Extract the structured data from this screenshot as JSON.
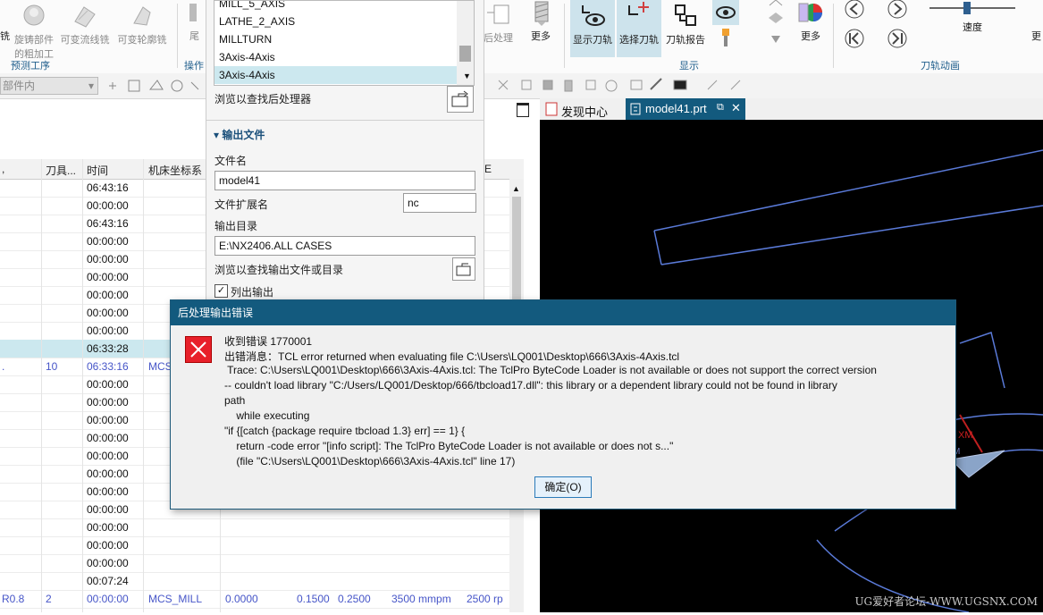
{
  "ribbon": {
    "left_buttons": [
      {
        "label": "旋铸部件\n的粗加工",
        "icon": "cast-part-icon"
      },
      {
        "label": "可变流线铣",
        "icon": "streamline-icon"
      },
      {
        "label": "可变轮廓铣",
        "icon": "variable-contour-icon"
      }
    ],
    "group_predict": "预测工序",
    "group_ops_partial": "操作",
    "partial_left_label": "铣",
    "partial_label2": "尾",
    "postprocess_partial": "后处理",
    "more_label_1": "更多",
    "show_toolpath": "显示刀轨",
    "select_toolpath": "选择刀轨",
    "toolpath_report": "刀轨报告",
    "more_label_2": "更多",
    "group_display": "显示",
    "speed_label": "速度",
    "more_label_3": "更",
    "group_animation": "刀轨动画"
  },
  "toolbar2": {
    "filter_value": "部件内"
  },
  "grid": {
    "headers": [
      "刀具...",
      "时间",
      "机床坐标系",
      "E"
    ],
    "rows": [
      {
        "time": "06:43:16"
      },
      {
        "time": "00:00:00"
      },
      {
        "time": "06:43:16"
      },
      {
        "time": "00:00:00"
      },
      {
        "time": "00:00:00"
      },
      {
        "time": "00:00:00"
      },
      {
        "time": "00:00:00"
      },
      {
        "time": "00:00:00"
      },
      {
        "time": "00:00:00"
      },
      {
        "time": "06:33:28",
        "selected": true
      },
      {
        "name": ".",
        "tool": "10",
        "time": "06:33:16",
        "mcs": "MCS",
        "blue": true
      },
      {
        "time": "00:00:00"
      },
      {
        "time": "00:00:00"
      },
      {
        "time": "00:00:00"
      },
      {
        "time": "00:00:00"
      },
      {
        "time": "00:00:00"
      },
      {
        "time": "00:00:00"
      },
      {
        "time": "00:00:00"
      },
      {
        "time": "00:00:00"
      },
      {
        "time": "00:00:00"
      },
      {
        "time": "00:00:00"
      },
      {
        "time": "00:00:00"
      },
      {
        "time": "00:07:24"
      },
      {
        "name": "R0.8",
        "tool": "2",
        "time": "00:00:00",
        "mcs": "MCS_MILL",
        "c1": "0.0000",
        "c2": "0.1500",
        "c3": "0.2500",
        "c4": "3500 mmpm",
        "c5": "2500 rp",
        "blue": true
      }
    ]
  },
  "post_panel": {
    "postprocessors": [
      "MILL_5_AXIS",
      "LATHE_2_AXIS",
      "MILLTURN",
      "3Axis-4Axis",
      "3Axis-4Axis"
    ],
    "selected_index": 4,
    "browse_post_label": "浏览以查找后处理器",
    "output_section": "输出文件",
    "filename_label": "文件名",
    "filename_value": "model41",
    "extension_label": "文件扩展名",
    "extension_value": "nc",
    "outdir_label": "输出目录",
    "outdir_value": "E:\\NX2406.ALL CASES",
    "browse_out_label": "浏览以查找输出文件或目录",
    "list_output_label": "列出输出",
    "list_output_checked": true
  },
  "tabs": {
    "discovery": "发现中心",
    "model": "model41.prt"
  },
  "viewport": {
    "labels": [
      "XM",
      "M"
    ],
    "watermark": "UG爱好者论坛-WWW.UGSNX.COM"
  },
  "dialog": {
    "title": "后处理输出错误",
    "lines": [
      "收到错误 1770001",
      "出错消息：TCL error returned when evaluating file C:\\Users\\LQ001\\Desktop\\666\\3Axis-4Axis.tcl",
      " Trace: C:\\Users\\LQ001\\Desktop\\666\\3Axis-4Axis.tcl: The TclPro ByteCode Loader is not available or does not support the correct version",
      "-- couldn't load library \"C:/Users/LQ001/Desktop/666/tbcload17.dll\": this library or a dependent library could not be found in library",
      "path",
      "    while executing",
      "\"if {[catch {package require tbcload 1.3} err] == 1} {",
      "    return -code error \"[info script]: The TclPro ByteCode Loader is not available or does not s...\"",
      "    (file \"C:\\Users\\LQ001\\Desktop\\666\\3Axis-4Axis.tcl\" line 17)"
    ],
    "ok_label": "确定(O)"
  },
  "colors": {
    "dialog_title_bg": "#135a7e",
    "selected_row": "#cce8ef",
    "blue_text": "#4655c8",
    "error_red": "#e8202a"
  }
}
